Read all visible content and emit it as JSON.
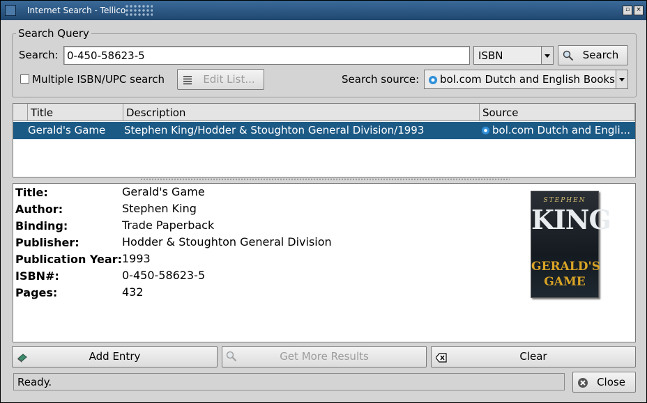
{
  "window": {
    "title": "Internet Search - Tellico"
  },
  "query": {
    "group_title": "Search Query",
    "search_label": "Search:",
    "search_value": "0-450-58623-5",
    "key_value": "ISBN",
    "search_button": "Search",
    "multiple_label": "Multiple ISBN/UPC search",
    "multiple_checked": false,
    "edit_list_button": "Edit List...",
    "source_label": "Search source:",
    "source_value": "bol.com Dutch and English Books"
  },
  "results": {
    "columns": [
      "Title",
      "Description",
      "Source"
    ],
    "rows": [
      {
        "title": "Gerald's Game",
        "description": "Stephen King/Hodder & Stoughton General Division/1993",
        "source": "bol.com Dutch and Engli..."
      }
    ]
  },
  "details": {
    "fields": [
      {
        "label": "Title:",
        "value": "Gerald's Game"
      },
      {
        "label": "Author:",
        "value": "Stephen King"
      },
      {
        "label": "Binding:",
        "value": "Trade Paperback"
      },
      {
        "label": "Publisher:",
        "value": "Hodder & Stoughton General Division"
      },
      {
        "label": "Publication Year:",
        "value": "1993"
      },
      {
        "label": "ISBN#:",
        "value": "0-450-58623-5"
      },
      {
        "label": "Pages:",
        "value": "432"
      }
    ],
    "cover": {
      "line1": "STEPHEN",
      "line2": "KING",
      "line3": "GERALD'S",
      "line4": "GAME"
    }
  },
  "actions": {
    "add_entry": "Add Entry",
    "get_more_results": "Get More Results",
    "clear": "Clear",
    "close": "Close"
  },
  "status": {
    "text": "Ready."
  },
  "colors": {
    "selection": "#1c5a86",
    "titlebar": "#2a5580"
  }
}
